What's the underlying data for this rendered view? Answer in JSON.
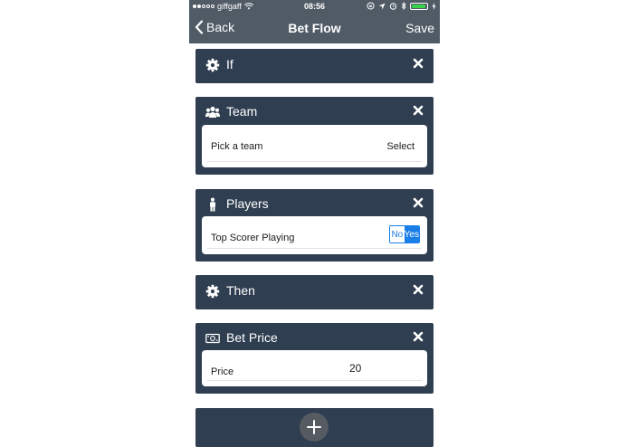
{
  "status_bar": {
    "carrier": "giffgaff",
    "time": "08:56"
  },
  "nav": {
    "back_label": "Back",
    "title": "Bet Flow",
    "save_label": "Save"
  },
  "cards": [
    {
      "title": "If",
      "icon": "gear-icon"
    },
    {
      "title": "Team",
      "icon": "users-icon",
      "row_label": "Pick a team",
      "row_action": "Select"
    },
    {
      "title": "Players",
      "icon": "person-icon",
      "row_label": "Top Scorer Playing",
      "toggle": {
        "off": "No",
        "on": "Yes",
        "selected": "Yes"
      }
    },
    {
      "title": "Then",
      "icon": "gear-icon"
    },
    {
      "title": "Bet Price",
      "icon": "money-icon",
      "row_label": "Price",
      "value": "20"
    }
  ],
  "colors": {
    "nav_bg": "#505b66",
    "card_bg": "#2f3e51",
    "toggle_accent": "#1a7ee8",
    "add_button": "#555b61"
  }
}
